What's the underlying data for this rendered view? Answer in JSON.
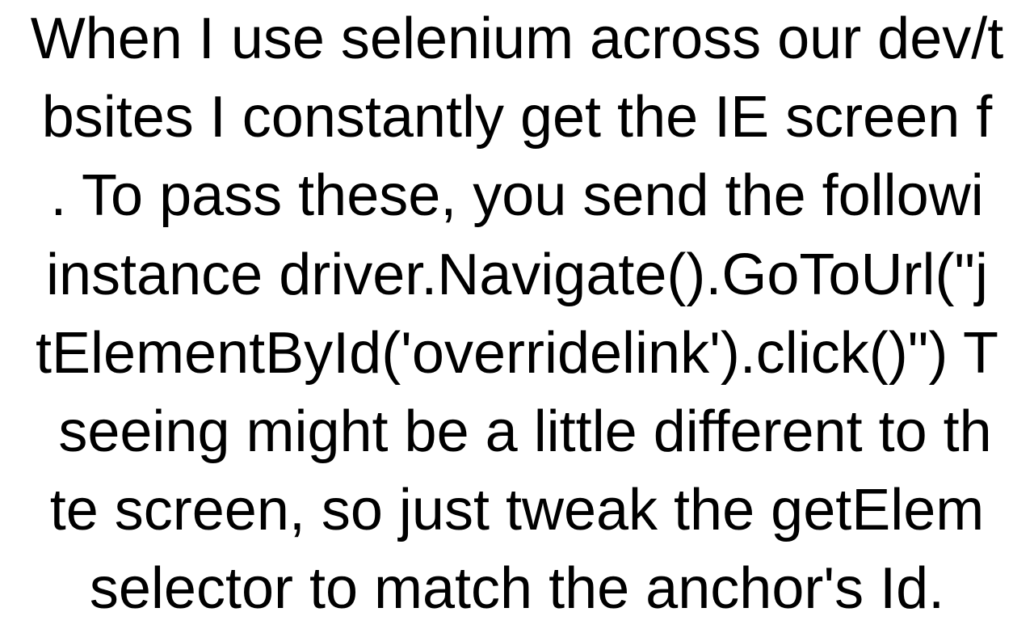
{
  "body": {
    "text": "When I use selenium across our dev/t\nbsites I constantly get the IE screen f\n. To pass these, you send the followi\ninstance driver.Navigate().GoToUrl(\"j\ntElementById('overridelink').click()\") T\n seeing might be a little different to th\nte screen, so just tweak the getElem\nselector to match the anchor's Id."
  }
}
